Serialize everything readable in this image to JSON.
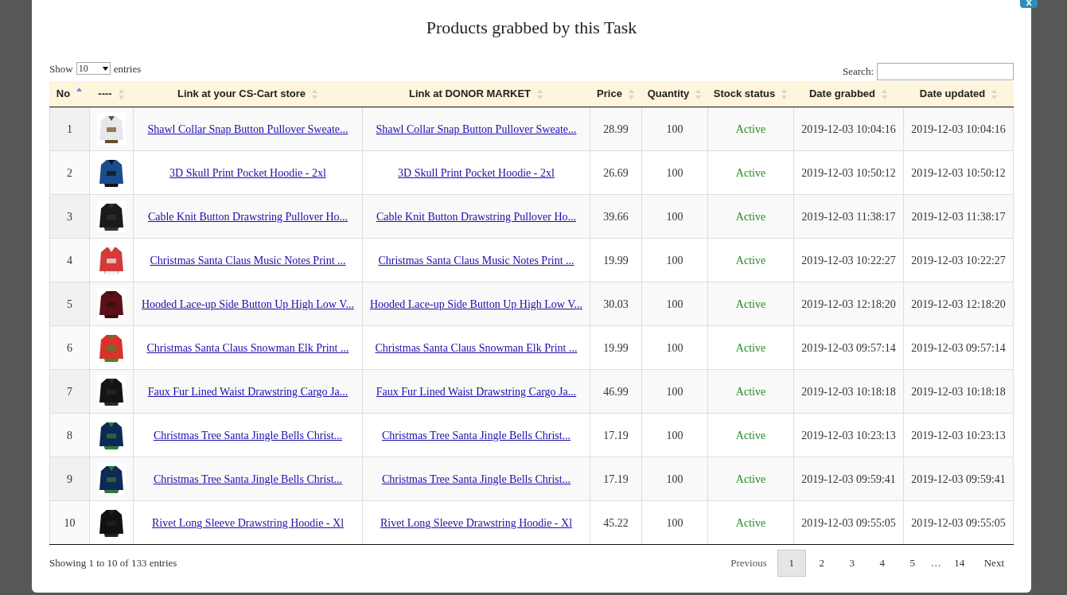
{
  "dialog": {
    "title": "Products grabbed by this Task",
    "close_label": "x"
  },
  "length": {
    "before": "Show",
    "value": "10",
    "after": "entries"
  },
  "search": {
    "label": "Search:"
  },
  "table": {
    "columns": [
      {
        "label": "No",
        "sorted": true
      },
      {
        "label": "----",
        "sorted": false
      },
      {
        "label": "Link at your CS-Cart store",
        "sorted": false
      },
      {
        "label": "Link at DONOR MARKET",
        "sorted": false
      },
      {
        "label": "Price",
        "sorted": false
      },
      {
        "label": "Quantity",
        "sorted": false
      },
      {
        "label": "Stock status",
        "sorted": false
      },
      {
        "label": "Date grabbed",
        "sorted": false
      },
      {
        "label": "Date updated",
        "sorted": false
      }
    ],
    "rows": [
      {
        "no": "1",
        "store_link": "Shawl Collar Snap Button Pullover Sweate...",
        "donor_link": "Shawl Collar Snap Button Pullover Sweate...",
        "price": "28.99",
        "quantity": "100",
        "stock": "Active",
        "grabbed": "2019-12-03 10:04:16",
        "updated": "2019-12-03 10:04:16"
      },
      {
        "no": "2",
        "store_link": "3D Skull Print Pocket Hoodie - 2xl",
        "donor_link": "3D Skull Print Pocket Hoodie - 2xl",
        "price": "26.69",
        "quantity": "100",
        "stock": "Active",
        "grabbed": "2019-12-03 10:50:12",
        "updated": "2019-12-03 10:50:12"
      },
      {
        "no": "3",
        "store_link": "Cable Knit Button Drawstring Pullover Ho...",
        "donor_link": "Cable Knit Button Drawstring Pullover Ho...",
        "price": "39.66",
        "quantity": "100",
        "stock": "Active",
        "grabbed": "2019-12-03 11:38:17",
        "updated": "2019-12-03 11:38:17"
      },
      {
        "no": "4",
        "store_link": "Christmas Santa Claus Music Notes Print ...",
        "donor_link": "Christmas Santa Claus Music Notes Print ...",
        "price": "19.99",
        "quantity": "100",
        "stock": "Active",
        "grabbed": "2019-12-03 10:22:27",
        "updated": "2019-12-03 10:22:27"
      },
      {
        "no": "5",
        "store_link": "Hooded Lace-up Side Button Up High Low V...",
        "donor_link": "Hooded Lace-up Side Button Up High Low V...",
        "price": "30.03",
        "quantity": "100",
        "stock": "Active",
        "grabbed": "2019-12-03 12:18:20",
        "updated": "2019-12-03 12:18:20"
      },
      {
        "no": "6",
        "store_link": "Christmas Santa Claus Snowman Elk Print ...",
        "donor_link": "Christmas Santa Claus Snowman Elk Print ...",
        "price": "19.99",
        "quantity": "100",
        "stock": "Active",
        "grabbed": "2019-12-03 09:57:14",
        "updated": "2019-12-03 09:57:14"
      },
      {
        "no": "7",
        "store_link": "Faux Fur Lined Waist Drawstring Cargo Ja...",
        "donor_link": "Faux Fur Lined Waist Drawstring Cargo Ja...",
        "price": "46.99",
        "quantity": "100",
        "stock": "Active",
        "grabbed": "2019-12-03 10:18:18",
        "updated": "2019-12-03 10:18:18"
      },
      {
        "no": "8",
        "store_link": "Christmas Tree Santa Jingle Bells Christ...",
        "donor_link": "Christmas Tree Santa Jingle Bells Christ...",
        "price": "17.19",
        "quantity": "100",
        "stock": "Active",
        "grabbed": "2019-12-03 10:23:13",
        "updated": "2019-12-03 10:23:13"
      },
      {
        "no": "9",
        "store_link": "Christmas Tree Santa Jingle Bells Christ...",
        "donor_link": "Christmas Tree Santa Jingle Bells Christ...",
        "price": "17.19",
        "quantity": "100",
        "stock": "Active",
        "grabbed": "2019-12-03 09:59:41",
        "updated": "2019-12-03 09:59:41"
      },
      {
        "no": "10",
        "store_link": "Rivet Long Sleeve Drawstring Hoodie - Xl",
        "donor_link": "Rivet Long Sleeve Drawstring Hoodie - Xl",
        "price": "45.22",
        "quantity": "100",
        "stock": "Active",
        "grabbed": "2019-12-03 09:55:05",
        "updated": "2019-12-03 09:55:05"
      }
    ]
  },
  "info": "Showing 1 to 10 of 133 entries",
  "pagination": {
    "previous": "Previous",
    "next": "Next",
    "pages": [
      {
        "label": "1",
        "selected": true
      },
      {
        "label": "2",
        "selected": false
      },
      {
        "label": "3",
        "selected": false
      },
      {
        "label": "4",
        "selected": false
      },
      {
        "label": "5",
        "selected": false
      }
    ],
    "ellipsis": "…",
    "last_pages": [
      {
        "label": "14",
        "selected": false
      }
    ]
  }
}
